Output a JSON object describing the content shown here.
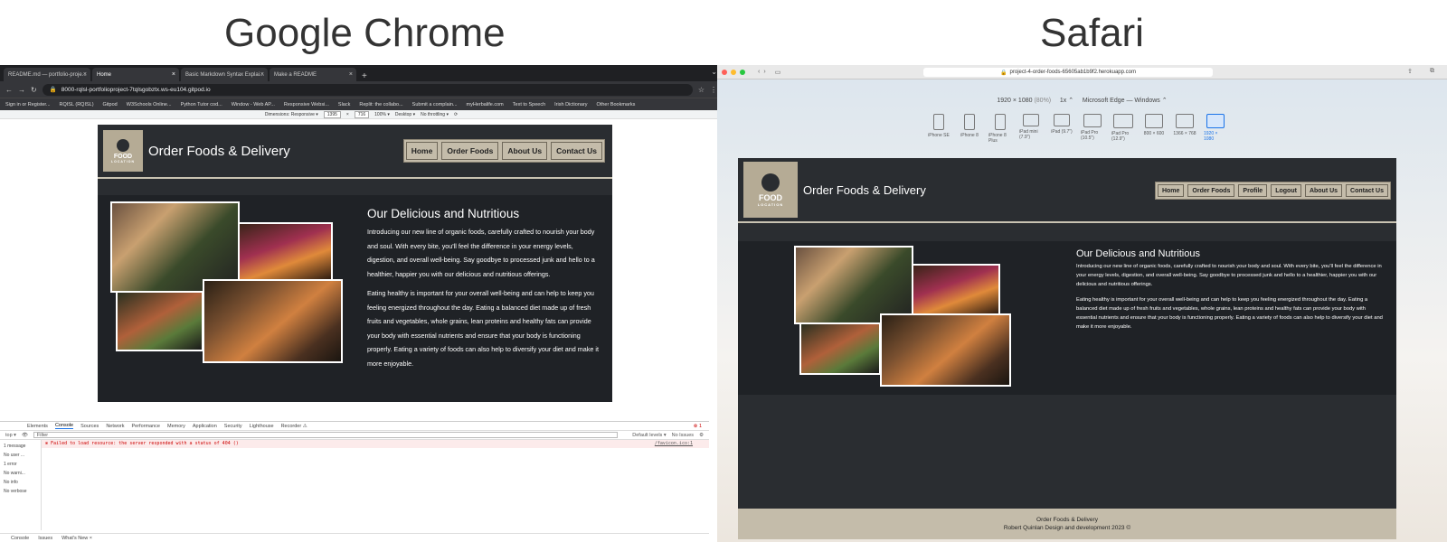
{
  "headings": {
    "chrome": "Google Chrome",
    "safari": "Safari"
  },
  "chrome": {
    "tabs": [
      {
        "label": "README.md — portfolio-proje..."
      },
      {
        "label": "Home"
      },
      {
        "label": "Basic Markdown Syntax Explai..."
      },
      {
        "label": "Make a README"
      }
    ],
    "url": "8000-rqlsl-portfolioproject-7tqlsgobztx.ws-eu104.gitpod.io",
    "bookmarks": [
      "Sign in or Register...",
      "RQISL (RQISL)",
      "Gitpod",
      "W3Schools Online...",
      "Python Tutor cod...",
      "Window - Web AP...",
      "Responsive Websi...",
      "Slack",
      "Replit: the collabo...",
      "Submit a complain...",
      "myHerbalife.com",
      "Text to Speech",
      "Irish Dictionary",
      "Other Bookmarks"
    ],
    "device_toolbar": {
      "dimensions": "Dimensions: Responsive ▾",
      "width": "1395",
      "height": "716",
      "zoom": "100% ▾",
      "mode": "Desktop ▾",
      "throttle": "No throttling ▾"
    },
    "devtools": {
      "tabs": [
        "Elements",
        "Console",
        "Sources",
        "Network",
        "Performance",
        "Memory",
        "Application",
        "Security",
        "Lighthouse",
        "Recorder ⚠"
      ],
      "error_count": "1",
      "context": "top ▾",
      "filter_placeholder": "Filter",
      "levels": "Default levels ▾",
      "issues": "No Issues",
      "sidebar": [
        "1 message",
        "No user ...",
        "1 error",
        "No warni...",
        "No info",
        "No verbose"
      ],
      "error_msg": "Failed to load resource: the server responded with a status of 404 ()",
      "error_src": "/favicon.ico:1",
      "bottom_tabs": [
        "Console",
        "Issues",
        "What's New ×"
      ]
    }
  },
  "site": {
    "brand": "Order Foods & Delivery",
    "logo_text": "FOOD",
    "logo_sub": "LOCATION",
    "nav_chrome": [
      "Home",
      "Order Foods",
      "About Us",
      "Contact Us"
    ],
    "nav_safari": [
      "Home",
      "Order Foods",
      "Profile",
      "Logout",
      "About Us",
      "Contact Us"
    ],
    "hero_title": "Our Delicious and Nutritious",
    "para1": "Introducing our new line of organic foods, carefully crafted to nourish your body and soul. With every bite, you'll feel the difference in your energy levels, digestion, and overall well-being. Say goodbye to processed junk and hello to a healthier, happier you with our delicious and nutritious offerings.",
    "para2": "Eating healthy is important for your overall well-being and can help to keep you feeling energized throughout the day. Eating a balanced diet made up of fresh fruits and vegetables, whole grains, lean proteins and healthy fats can provide your body with essential nutrients and ensure that your body is functioning properly. Eating a variety of foods can also help to diversify your diet and make it more enjoyable.",
    "footer1": "Order Foods & Delivery",
    "footer2": "Robert Quinlan Design and development 2023 ©"
  },
  "safari": {
    "url": "project-4-order-foods-65605ab1b9f2.herokuapp.com",
    "resolution": "1920 × 1080",
    "scale": "(80%)",
    "zoom": "1x ⌃",
    "agent": "Microsoft Edge — Windows ⌃",
    "devices": [
      "iPhone SE",
      "iPhone 8",
      "iPhone 8 Plus",
      "iPad mini (7.9\")",
      "iPad (9.7\")",
      "iPad Pro (10.5\")",
      "iPad Pro (12.9\")",
      "800 × 600",
      "1366 × 768",
      "1920 × 1080"
    ]
  }
}
